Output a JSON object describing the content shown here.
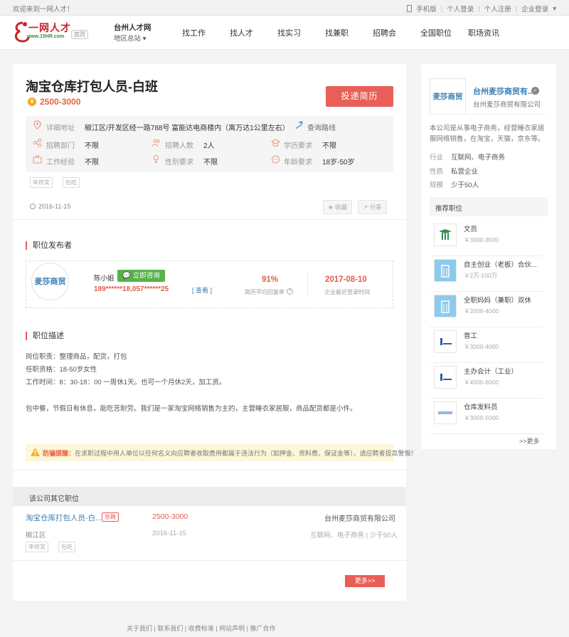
{
  "topbar": {
    "welcome": "欢迎来到一网人才！",
    "mobile": "手机版",
    "personal_login": "个人登录",
    "personal_register": "个人注册",
    "company_login": "企业登录"
  },
  "header": {
    "logo_text": "一网人才",
    "logo_sub": "www.15HR.com",
    "home_badge": "首页",
    "site_name": "台州人才网",
    "region": "地区总站",
    "nav": [
      "找工作",
      "找人才",
      "找实习",
      "找兼职",
      "招聘会",
      "全国职位",
      "职场资讯"
    ]
  },
  "job": {
    "title": "淘宝仓库打包人员-白班",
    "salary": "2500-3000",
    "apply_label": "投递简历",
    "address_label": "详细地址",
    "address": "椒江区/开发区经一路788号 富能达电商楼内（离万达1公里左右）",
    "route_label": "查询路线",
    "dept_label": "招聘部门",
    "dept": "不限",
    "count_label": "招聘人数",
    "count": "2人",
    "edu_label": "学历要求",
    "edu": "不限",
    "exp_label": "工作经验",
    "exp": "不限",
    "gender_label": "性别要求",
    "gender": "不限",
    "age_label": "年龄要求",
    "age": "18岁-50岁",
    "tags": [
      "年终奖",
      "包吃"
    ],
    "date": "2016-11-15",
    "fav_label": "收藏",
    "share_label": "分享"
  },
  "publisher": {
    "section_title": "职位发布者",
    "company_logo": "麦莎商贸",
    "name": "陈小姐",
    "consult_label": "立即咨询",
    "phone": "189******18,057******25",
    "view_label": "[ 查看 ]",
    "reply_rate": "91%",
    "reply_label": "简历平均回复率",
    "last_login": "2017-08-10",
    "last_login_label": "企业最近登录时间"
  },
  "description": {
    "section_title": "职位描述",
    "lines": [
      "岗位职责：整理商品，配货，打包",
      "任职资格：18-50岁女性",
      "工作时间：8：30-18：00 一周休1天。也可一个月休2天，加工资。",
      "包中餐，节假日有休息，能吃苦耐劳。我们是一家淘宝网络销售为主的，主营睡衣家居服，商品配货都是小件。"
    ],
    "warning_bold": "防骗提醒：",
    "warning_text": "在求职过程中用人单位以任何名义向应聘者收取费用都属于违法行为（如押金、资料费、保证金等），请应聘者提高警惕！"
  },
  "other_jobs": {
    "title": "该公司其它职位",
    "items": [
      {
        "name": "淘宝仓库打包人员-白...",
        "badge": "急聘",
        "salary": "2500-3000",
        "company": "台州麦莎商贸有限公司",
        "location": "椒江区",
        "date": "2016-11-15",
        "industry": "互联网、电子商务 | 少于50人",
        "tags": [
          "年终奖",
          "包吃"
        ]
      }
    ],
    "more_label": "更多>>"
  },
  "company": {
    "logo": "麦莎商贸",
    "name": "台州麦莎商贸有...",
    "full_name": "台州麦莎商贸有限公司",
    "desc": "本公司是从事电子商务，经营睡衣家居服网络销售，在淘宝，天猫，京东等。",
    "industry_label": "行业",
    "industry": "互联网、电子商务",
    "nature_label": "性质",
    "nature": "私营企业",
    "size_label": "规模",
    "size": "少于50人"
  },
  "recommend": {
    "title": "推荐职位",
    "items": [
      {
        "title": "文员",
        "salary": "￥3000-3500",
        "thumb": "green-logo"
      },
      {
        "title": "自主创业（老板）合伙...",
        "salary": "￥2万-100万",
        "thumb": "building-icon"
      },
      {
        "title": "全职妈妈（兼职）双休",
        "salary": "￥2000-4000",
        "thumb": "building-icon"
      },
      {
        "title": "普工",
        "salary": "￥3000-4000",
        "thumb": "blue-logo"
      },
      {
        "title": "主办会计（工业）",
        "salary": "￥4000-6000",
        "thumb": "blue-logo"
      },
      {
        "title": "仓库发料员",
        "salary": "￥3000-5000",
        "thumb": "text-logo"
      }
    ],
    "more_label": ">>更多"
  },
  "footer": {
    "links": [
      "关于我们",
      "联系我们",
      "收费标准",
      "网站声明",
      "推广合作"
    ]
  },
  "colors": {
    "accent": "#e95f58",
    "link": "#3a7fb3",
    "green": "#55b348"
  }
}
